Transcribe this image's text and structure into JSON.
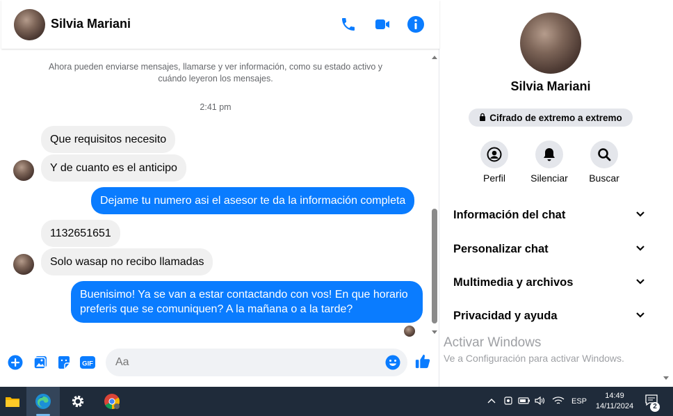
{
  "contact": {
    "name": "Silvia Mariani"
  },
  "chat": {
    "system_note": "Ahora pueden enviarse mensajes, llamarse y ver información, como su estado activo y cuándo leyeron los mensajes.",
    "timestamp": "2:41 pm",
    "messages": [
      {
        "direction": "incoming",
        "text": "Que requisitos necesito"
      },
      {
        "direction": "incoming",
        "text": "Y de cuanto es el anticipo"
      },
      {
        "direction": "outgoing",
        "text": "Dejame tu numero asi el asesor te da la información completa"
      },
      {
        "direction": "incoming",
        "text": "1132651651"
      },
      {
        "direction": "incoming",
        "text": "Solo wasap no recibo llamadas"
      },
      {
        "direction": "outgoing",
        "text": "Buenisimo! Ya se van a estar contactando con vos! En que horario preferis que se comuniquen? A la mañana o a la tarde?"
      }
    ]
  },
  "composer": {
    "placeholder": "Aa"
  },
  "info_panel": {
    "name": "Silvia Mariani",
    "e2e_label": "Cifrado de extremo a extremo",
    "actions": [
      {
        "label": "Perfil",
        "icon": "profile-icon"
      },
      {
        "label": "Silenciar",
        "icon": "bell-icon"
      },
      {
        "label": "Buscar",
        "icon": "search-icon"
      }
    ],
    "sections": [
      "Información del chat",
      "Personalizar chat",
      "Multimedia y archivos",
      "Privacidad y ayuda"
    ]
  },
  "watermark": {
    "title": "Activar Windows",
    "subtitle": "Ve a Configuración para activar Windows."
  },
  "taskbar": {
    "language": "ESP",
    "time": "14:49",
    "date": "14/11/2024",
    "notification_count": "2"
  },
  "colors": {
    "accent": "#0a7cff",
    "incoming_bubble": "#f0f0f0",
    "taskbar": "#1f2b3a"
  }
}
